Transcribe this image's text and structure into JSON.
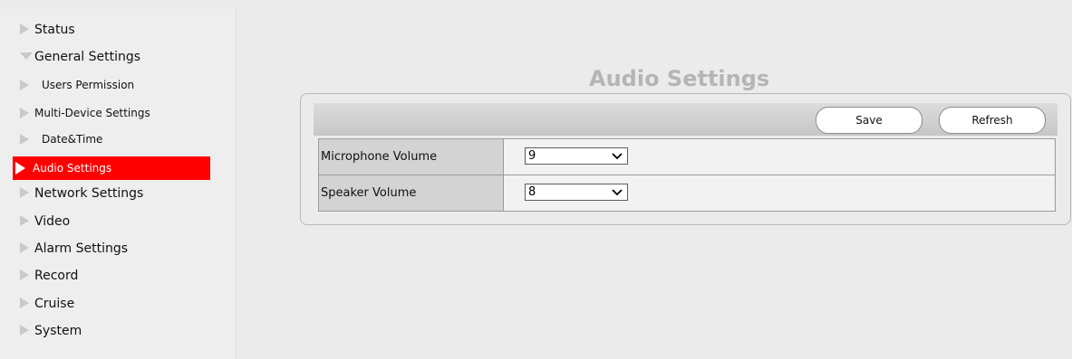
{
  "sidebar": {
    "items": [
      {
        "label": "Status"
      },
      {
        "label": "General Settings"
      },
      {
        "label": "Network Settings"
      },
      {
        "label": "Video"
      },
      {
        "label": "Alarm Settings"
      },
      {
        "label": "Record"
      },
      {
        "label": "Cruise"
      },
      {
        "label": "System"
      }
    ],
    "general_sub": [
      {
        "label": "Users Permission"
      },
      {
        "label": "Multi-Device Settings"
      },
      {
        "label": "Date&Time"
      },
      {
        "label": "Audio Settings",
        "active": true
      }
    ]
  },
  "main": {
    "title": "Audio Settings",
    "toolbar": {
      "save_label": "Save",
      "refresh_label": "Refresh"
    },
    "settings": [
      {
        "label": "Microphone Volume",
        "value": "9"
      },
      {
        "label": "Speaker Volume",
        "value": "8"
      }
    ]
  },
  "colors": {
    "active_bg": "#ff0000",
    "title": "#b5b5b5"
  },
  "icons": {
    "collapsed": "triangle-right-icon",
    "expanded": "triangle-down-icon",
    "select": "chevron-down-icon"
  }
}
